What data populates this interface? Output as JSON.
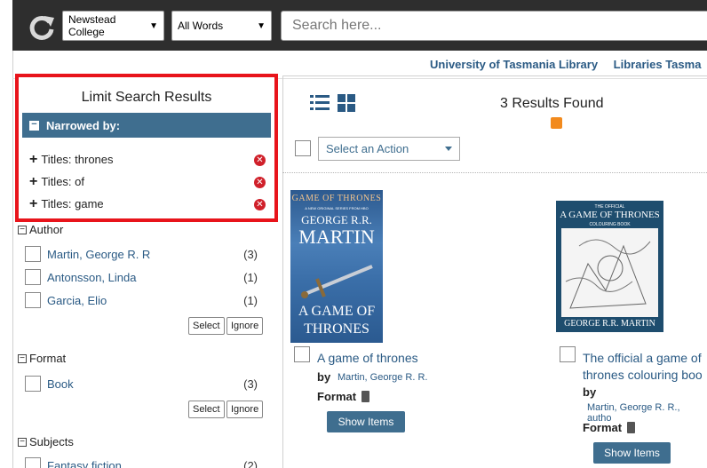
{
  "header": {
    "library_select": "Newstead College",
    "search_mode_select": "All Words",
    "search_placeholder": "Search here..."
  },
  "library_links": [
    "University of Tasmania Library",
    "Libraries Tasma"
  ],
  "limit_panel": {
    "title": "Limit Search Results",
    "narrowed_label": "Narrowed by:",
    "filters": [
      "Titles: thrones",
      "Titles: of",
      "Titles: game"
    ]
  },
  "facets": {
    "author": {
      "heading": "Author",
      "items": [
        {
          "label": "Martin, George R. R",
          "count": "(3)"
        },
        {
          "label": "Antonsson, Linda",
          "count": "(1)"
        },
        {
          "label": "Garcia, Elio",
          "count": "(1)"
        }
      ],
      "select_label": "Select",
      "ignore_label": "Ignore"
    },
    "format": {
      "heading": "Format",
      "items": [
        {
          "label": "Book",
          "count": "(3)"
        }
      ],
      "select_label": "Select",
      "ignore_label": "Ignore"
    },
    "subjects": {
      "heading": "Subjects",
      "items": [
        {
          "label": "Fantasy fiction",
          "count": "(2)"
        }
      ]
    }
  },
  "results": {
    "count_text": "3 Results Found",
    "action_select": "Select an Action",
    "items": [
      {
        "title": "A game of thrones",
        "by_label": "by",
        "author": "Martin, George R. R.",
        "format_label": "Format",
        "button": "Show Items",
        "cover": {
          "series": "GAME OF THRONES",
          "tagline": "A NEW ORIGINAL SERIES FROM HBO",
          "author_line1": "GEORGE R.R.",
          "author_line2": "MARTIN",
          "title_line1": "A GAME OF",
          "title_line2": "THRONES"
        }
      },
      {
        "title": "The official a game of thrones colouring boo",
        "by_label": "by",
        "author": "Martin, George R. R., autho",
        "format_label": "Format",
        "button": "Show Items",
        "cover": {
          "prefix": "THE OFFICIAL",
          "title": "A GAME OF THRONES",
          "subtitle": "COLOURING BOOK",
          "author": "GEORGE R.R. MARTIN"
        }
      }
    ]
  },
  "colors": {
    "topbar": "#2e2e2e",
    "accent": "#3f6e8f",
    "link": "#2a5a84",
    "highlight_border": "#e8141b",
    "remove_icon": "#d0202a"
  }
}
